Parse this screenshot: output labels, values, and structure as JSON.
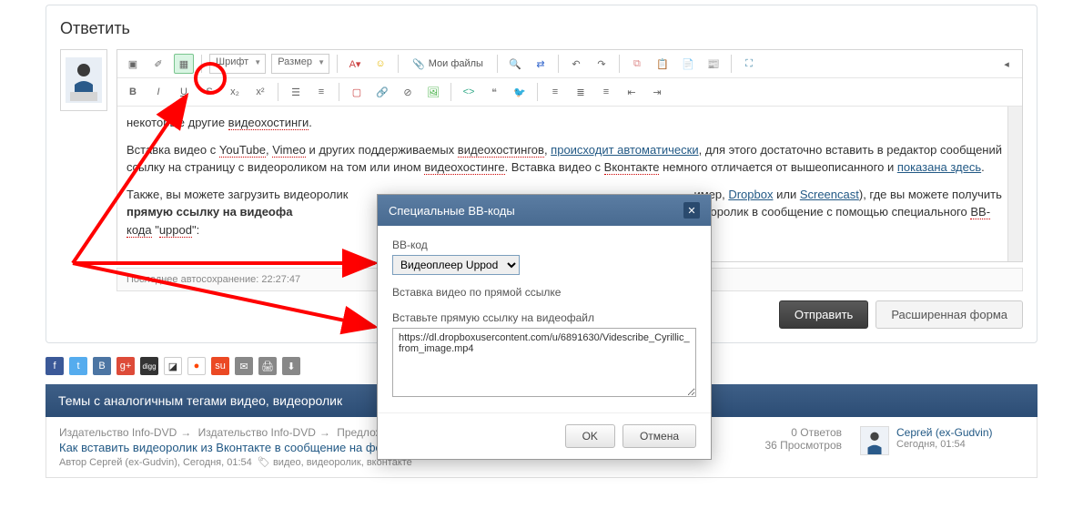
{
  "reply": {
    "title": "Ответить",
    "font_label": "Шрифт",
    "size_label": "Размер",
    "myfiles": "Мои файлы",
    "autosave": "Последнее автосохранение: 22:27:47",
    "submit": "Отправить",
    "advanced": "Расширенная форма"
  },
  "content": {
    "p1_a": "некоторые другие ",
    "p1_b": "видеохостинги",
    "p1_c": ".",
    "p2_a": "Вставка видео с ",
    "p2_yt": "YouTube",
    "p2_b": ", ",
    "p2_vm": "Vimeo",
    "p2_c": " и других поддерживаемых ",
    "p2_vh": "видеохостингов",
    "p2_d": ", ",
    "p2_auto": "происходит автоматически",
    "p2_e": ", для этого достаточно вставить в редактор сообщений ссылку на страницу с видеороликом на том или ином ",
    "p2_vh2": "видеохостинге",
    "p2_f": ". Вставка видео с ",
    "p2_vk": "Вконтакте",
    "p2_g": " немного отличается от вышеописанного и ",
    "p2_here": "показана здесь",
    "p2_h": ".",
    "p3_a": "Также, вы можете загрузить видеоролик",
    "p3_b": "имер, ",
    "p3_db": "Dropbox",
    "p3_c": " или ",
    "p3_sc": "Screencast",
    "p3_d": "), где вы можете получить ",
    "p3_bold": "прямую ссылку на видеофа",
    "p3_e": "ставить видеоролик в сообщение с помощью специального ",
    "p3_bb": "BB-кода",
    "p3_f": " \"",
    "p3_up": "uppod",
    "p3_g": "\":"
  },
  "modal": {
    "title": "Специальные BB-коды",
    "bbcode_label": "BB-код",
    "select_value": "Видеоплеер Uppod",
    "hint": "Вставка видео по прямой ссылке",
    "url_label": "Вставьте прямую ссылку на видеофайл",
    "url_value": "https://dl.dropboxusercontent.com/u/6891630/Videscribe_Cyrillic_from_image.mp4",
    "ok": "OK",
    "cancel": "Отмена"
  },
  "related": {
    "header": "Темы с аналогичным тегами видео, видеоролик",
    "crumb1": "Издательство Info-DVD",
    "crumb2": "Издательство Info-DVD",
    "crumb3": "Предложения и вопросы по работе форума",
    "topic": "Как вставить видеоролик из Вконтакте в сообщение на форуме?",
    "meta_prefix": "Автор Сергей (ex-Gudvin), Сегодня, 01:54",
    "tags": "видео, видеоролик, вконтакте",
    "replies": "0 Ответов",
    "views": "36 Просмотров",
    "user": "Сергей (ex-Gudvin)",
    "date": "Сегодня, 01:54"
  }
}
